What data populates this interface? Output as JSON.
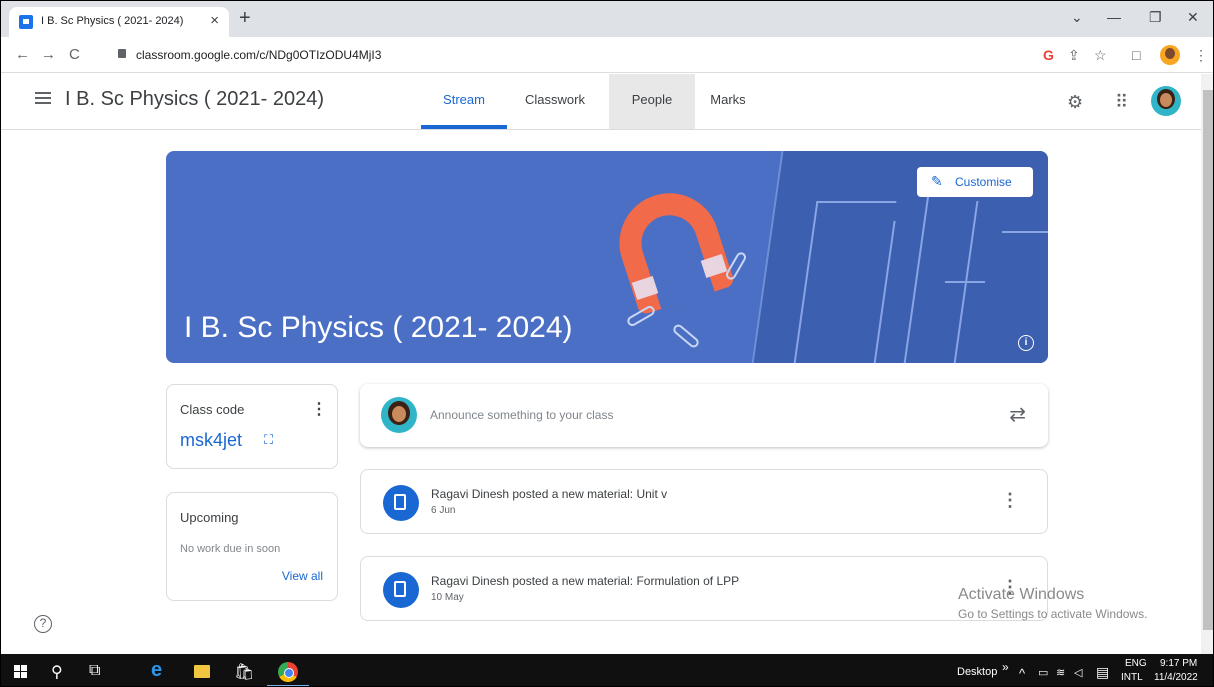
{
  "browser": {
    "tab_title": "I B. Sc Physics ( 2021- 2024)",
    "tab_close": "×",
    "new_tab": "+",
    "url": "classroom.google.com/c/NDg0OTIzODU4MjI3",
    "win_min": "—",
    "win_restore": "❐",
    "win_close": "✕",
    "win_menu": "⌄",
    "back": "←",
    "forward": "→",
    "reload": "C",
    "google_icon": "G",
    "share_icon": "⇪",
    "star_icon": "☆",
    "sidepanel_icon": "□",
    "menu_icon": "⋮"
  },
  "header": {
    "class_name": "I B. Sc Physics ( 2021- 2024)",
    "tabs": [
      {
        "label": "Stream",
        "active": true
      },
      {
        "label": "Classwork",
        "active": false
      },
      {
        "label": "People",
        "active": false
      },
      {
        "label": "Marks",
        "active": false
      }
    ],
    "settings_icon": "⚙",
    "apps_icon": "⠿"
  },
  "banner": {
    "title": "I B. Sc Physics ( 2021- 2024)",
    "customise_label": "Customise",
    "pencil_icon": "✎",
    "info_icon": "i",
    "color": "#4a6fc4"
  },
  "class_code": {
    "label": "Class code",
    "value": "msk4jet",
    "dots": "⋮",
    "expand_icon": "⛶"
  },
  "upcoming": {
    "title": "Upcoming",
    "message": "No work due in soon",
    "view_all": "View all"
  },
  "stream": {
    "announce_placeholder": "Announce something to your class",
    "repost_icon": "⇄",
    "posts": [
      {
        "title": "Ragavi Dinesh posted a new material: Unit v",
        "date": "6 Jun",
        "dots": "⋮"
      },
      {
        "title": "Ragavi Dinesh posted a new material: Formulation of LPP",
        "date": "10 May",
        "dots": "⋮"
      }
    ]
  },
  "help_icon": "?",
  "watermark": {
    "line1": "Activate Windows",
    "line2": "Go to Settings to activate Windows."
  },
  "taskbar": {
    "search_icon": "⚲",
    "taskview_icon": "⧉",
    "edge_icon": "e",
    "store_icon": "🛍",
    "desktop_label": "Desktop",
    "chevron": "»",
    "tray_up": "^",
    "lang_top": "ENG",
    "lang_bottom": "INTL",
    "time": "9:17 PM",
    "date": "11/4/2022",
    "notif_icon": "▤"
  },
  "colors": {
    "accent": "#1967d2",
    "banner": "#4a6fc4",
    "magnet": "#f16a4a"
  }
}
